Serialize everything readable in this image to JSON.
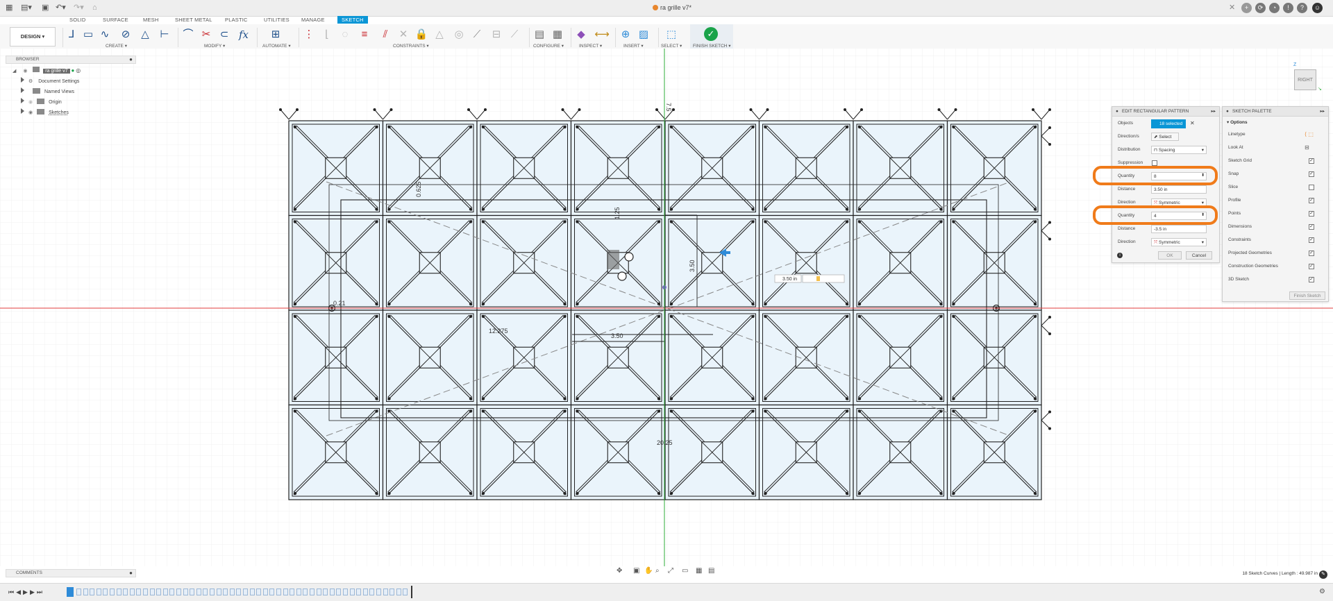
{
  "window": {
    "title": "ra grille v7*"
  },
  "toolbar": {
    "workspace": "DESIGN",
    "tabs": [
      "SOLID",
      "SURFACE",
      "MESH",
      "SHEET METAL",
      "PLASTIC",
      "UTILITIES",
      "MANAGE",
      "SKETCH"
    ],
    "active_tab": "SKETCH",
    "groups": {
      "create": "CREATE ▾",
      "modify": "MODIFY ▾",
      "automate": "AUTOMATE ▾",
      "constraints": "CONSTRAINTS ▾",
      "configure": "CONFIGURE ▾",
      "inspect": "INSPECT ▾",
      "insert": "INSERT ▾",
      "select": "SELECT ▾",
      "finish": "FINISH SKETCH ▾"
    }
  },
  "browser": {
    "header": "BROWSER",
    "root": "ra grille v7",
    "items": [
      "Document Settings",
      "Named Views",
      "Origin",
      "Sketches"
    ]
  },
  "viewcube": {
    "face": "RIGHT",
    "axis": "Z"
  },
  "sketch": {
    "dimensions": [
      "7.5",
      "0.625",
      "0.21",
      "12.275",
      "3.50",
      "3.50",
      "1.25",
      "20.25",
      "3.50 in"
    ]
  },
  "edit_pattern": {
    "title": "EDIT RECTANGULAR PATTERN",
    "objects_label": "Objects",
    "objects_value": "18 selected",
    "direction_label": "Direction/s",
    "direction_value": "Select",
    "distribution_label": "Distribution",
    "distribution_value": "Spacing",
    "suppression_label": "Suppression",
    "quantity1_label": "Quantity",
    "quantity1_value": "8",
    "distance1_label": "Distance",
    "distance1_value": "3.50 in",
    "direction1_label": "Direction",
    "direction1_value": "Symmetric",
    "quantity2_label": "Quantity",
    "quantity2_value": "4",
    "distance2_label": "Distance",
    "distance2_value": "-3.5 in",
    "direction2_label": "Direction",
    "direction2_value": "Symmetric",
    "ok": "OK",
    "cancel": "Cancel"
  },
  "sketch_palette": {
    "title": "SKETCH PALETTE",
    "section": "Options",
    "options": [
      {
        "label": "Linetype"
      },
      {
        "label": "Look At"
      },
      {
        "label": "Sketch Grid",
        "checked": true
      },
      {
        "label": "Snap",
        "checked": true
      },
      {
        "label": "Slice",
        "checked": false
      },
      {
        "label": "Profile",
        "checked": true
      },
      {
        "label": "Points",
        "checked": true
      },
      {
        "label": "Dimensions",
        "checked": true
      },
      {
        "label": "Constraints",
        "checked": true
      },
      {
        "label": "Projected Geometries",
        "checked": true
      },
      {
        "label": "Construction Geometries",
        "checked": true
      },
      {
        "label": "3D Sketch",
        "checked": true
      }
    ],
    "finish": "Finish Sketch"
  },
  "bottom": {
    "comments": "COMMENTS",
    "status": "18 Sketch Curves | Length : 49.987 in"
  },
  "colors": {
    "accent": "#0a96d6",
    "highlight": "#f07b1a",
    "finish_green": "#1aa34a",
    "x_axis": "#e23b3b",
    "y_axis": "#2fae3a"
  }
}
